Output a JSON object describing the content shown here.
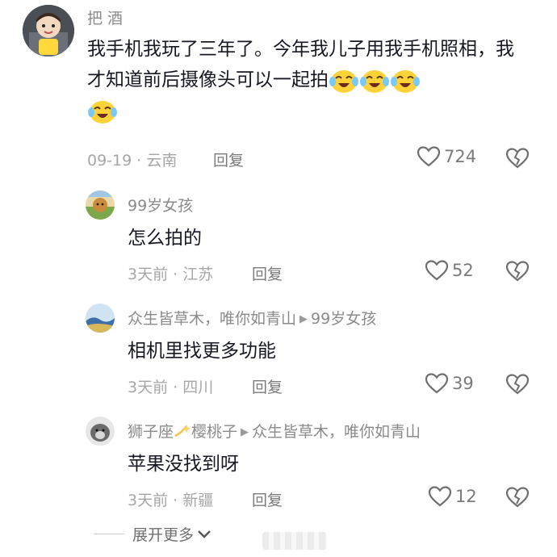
{
  "comments": [
    {
      "name": "把 酒",
      "text": "我手机我玩了三年了。今年我儿子用我手机照相，我才知道前后摄像头可以一起拍",
      "emoji": "crying-laughing-emoji",
      "emoji_count": 4,
      "meta": "09-19 · 云南",
      "reply_label": "回复",
      "likes": "724"
    },
    {
      "name": "99岁女孩",
      "text": "怎么拍的",
      "meta": "3天前 · 江苏",
      "reply_label": "回复",
      "likes": "52"
    },
    {
      "name": "众生皆草木，唯你如青山",
      "reply_to": "99岁女孩",
      "text": "相机里找更多功能",
      "meta": "3天前 · 四川",
      "reply_label": "回复",
      "likes": "39"
    },
    {
      "name_prefix": "狮子座",
      "name_suffix": "樱桃子",
      "reply_to": "众生皆草木，唯你如青山",
      "text": "苹果没找到呀",
      "meta": "3天前 · 新疆",
      "reply_label": "回复",
      "likes": "12"
    }
  ],
  "expand_more": "展开更多",
  "icons": {
    "like": "heart-outline-icon",
    "dislike": "broken-heart-outline-icon",
    "expand": "chevron-down-icon",
    "reply_arrow": "triangle-right-icon"
  },
  "colors": {
    "text": "#161823",
    "name": "#8a8a8a",
    "meta": "#a6a6a6",
    "emoji": "#ffd23a"
  }
}
